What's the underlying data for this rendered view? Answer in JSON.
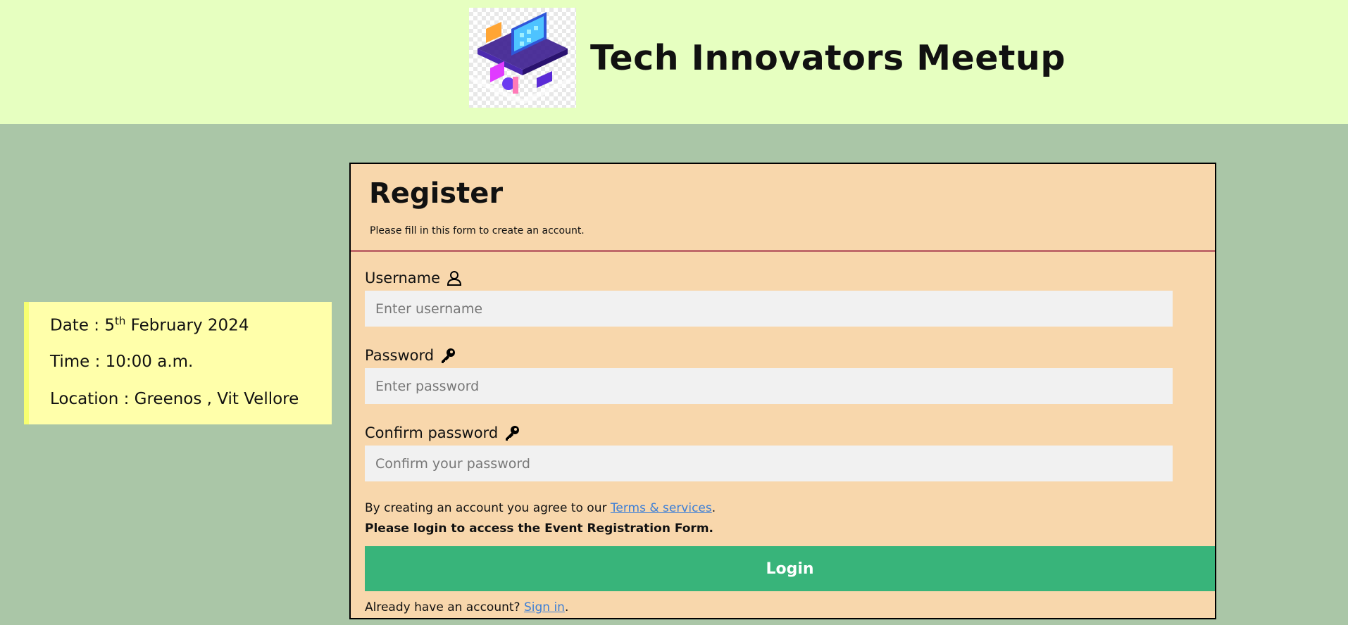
{
  "header": {
    "title": "Tech Innovators Meetup",
    "logo_icon": "isometric-tech-illustration"
  },
  "event_info": {
    "date_prefix": "Date : 5",
    "date_sup": "th",
    "date_suffix": " February 2024",
    "time": "Time : 10:00 a.m.",
    "location": "Location : Greenos , Vit Vellore"
  },
  "form": {
    "title": "Register",
    "subtitle": "Please fill in this form to create an account.",
    "username_label": "Username",
    "username_placeholder": "Enter username",
    "username_icon": "user-icon",
    "password_label": "Password",
    "password_placeholder": "Enter password",
    "password_icon": "key-icon",
    "confirm_label": "Confirm password",
    "confirm_placeholder": "Confirm your password",
    "confirm_icon": "key-icon",
    "terms_prefix": "By creating an account you agree to our ",
    "terms_link": "Terms & services",
    "terms_suffix": ".",
    "notice": "Please login to access the Event Registration Form.",
    "login_button": "Login",
    "signin_prefix": "Already have an account? ",
    "signin_link": "Sign in",
    "signin_suffix": "."
  },
  "colors": {
    "page_bg": "#aac6a7",
    "header_bg": "#e6ffc0",
    "info_bg": "#ffffaa",
    "form_bg": "#f8d7ac",
    "divider": "#c06a6a",
    "login_button": "#38b47a",
    "link": "#3d7fd6"
  }
}
